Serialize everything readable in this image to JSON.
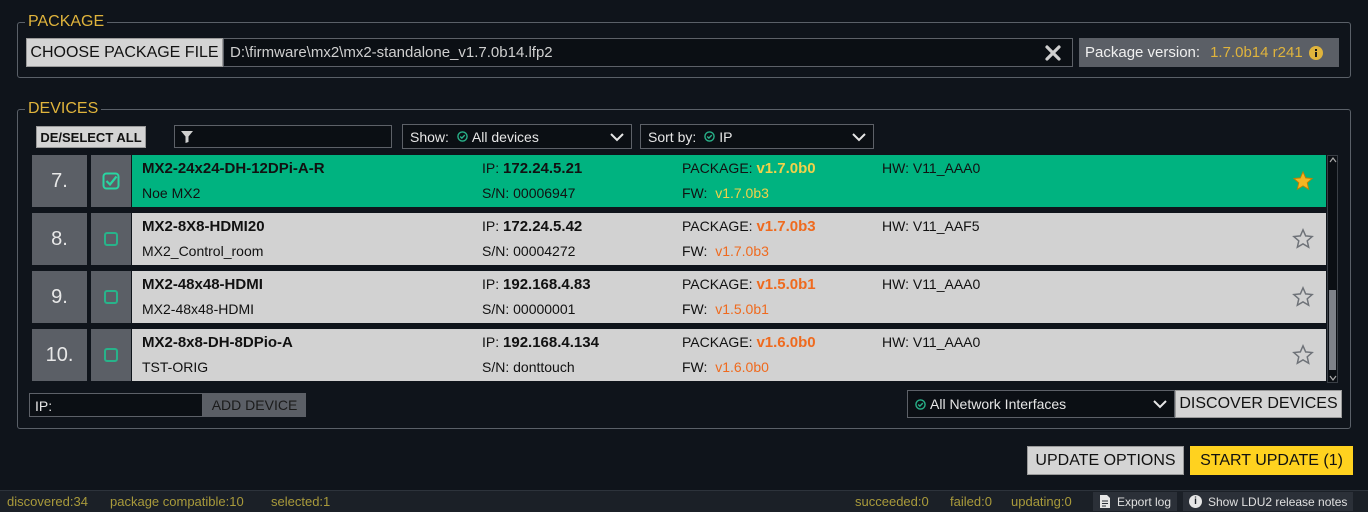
{
  "package": {
    "legend": "PACKAGE",
    "choose_label": "CHOOSE PACKAGE FILE",
    "file_path": "D:\\firmware\\mx2\\mx2-standalone_v1.7.0b14.lfp2",
    "version_label": "Package version:",
    "version_value": "1.7.0b14 r241"
  },
  "devices": {
    "legend": "DEVICES",
    "deselect_label": "DE/SELECT ALL",
    "filter_value": "",
    "show_label": "Show:",
    "show_value": "All devices",
    "sort_label": "Sort by:",
    "sort_value": "IP",
    "ip_prefix": "IP:",
    "sn_prefix": "S/N:",
    "package_prefix": "PACKAGE:",
    "fw_prefix": "FW:",
    "rows": [
      {
        "index": "7.",
        "name": "MX2-24x24-DH-12DPi-A-R",
        "label": "Noe MX2",
        "ip": "172.24.5.21",
        "sn": "00006947",
        "package": "v1.7.0b0",
        "fw": "v1.7.0b3",
        "hw": "HW: V11_AAA0",
        "selected": true,
        "favorite": true
      },
      {
        "index": "8.",
        "name": "MX2-8X8-HDMI20",
        "label": "MX2_Control_room",
        "ip": "172.24.5.42",
        "sn": "00004272",
        "package": "v1.7.0b3",
        "fw": "v1.7.0b3",
        "hw": "HW: V11_AAF5",
        "selected": false,
        "favorite": false
      },
      {
        "index": "9.",
        "name": "MX2-48x48-HDMI",
        "label": "MX2-48x48-HDMI",
        "ip": "192.168.4.83",
        "sn": "00000001",
        "package": "v1.5.0b1",
        "fw": "v1.5.0b1",
        "hw": "HW: V11_AAA0",
        "selected": false,
        "favorite": false
      },
      {
        "index": "10.",
        "name": "MX2-8x8-DH-8DPio-A",
        "label": "TST-ORIG",
        "ip": "192.168.4.134",
        "sn": "donttouch",
        "package": "v1.6.0b0",
        "fw": "v1.6.0b0",
        "hw": "HW: V11_AAA0",
        "selected": false,
        "favorite": false
      }
    ],
    "ip_input_label": "IP:",
    "ip_input_value": "",
    "add_device_label": "ADD DEVICE",
    "network_value": "All Network Interfaces",
    "discover_label": "DISCOVER DEVICES"
  },
  "actions": {
    "update_options_label": "UPDATE OPTIONS",
    "start_update_label": "START UPDATE (1)"
  },
  "status": {
    "discovered": "discovered:34",
    "compatible": "package compatible:10",
    "selected": "selected:1",
    "succeeded": "succeeded:0",
    "failed": "failed:0",
    "updating": "updating:0",
    "export_log": "Export log",
    "release_notes": "Show LDU2 release notes"
  },
  "colors": {
    "accent": "#e0b43c",
    "selected_row": "#00b380",
    "package_orange": "#ef6a1e",
    "start_button": "#ffd21f"
  }
}
